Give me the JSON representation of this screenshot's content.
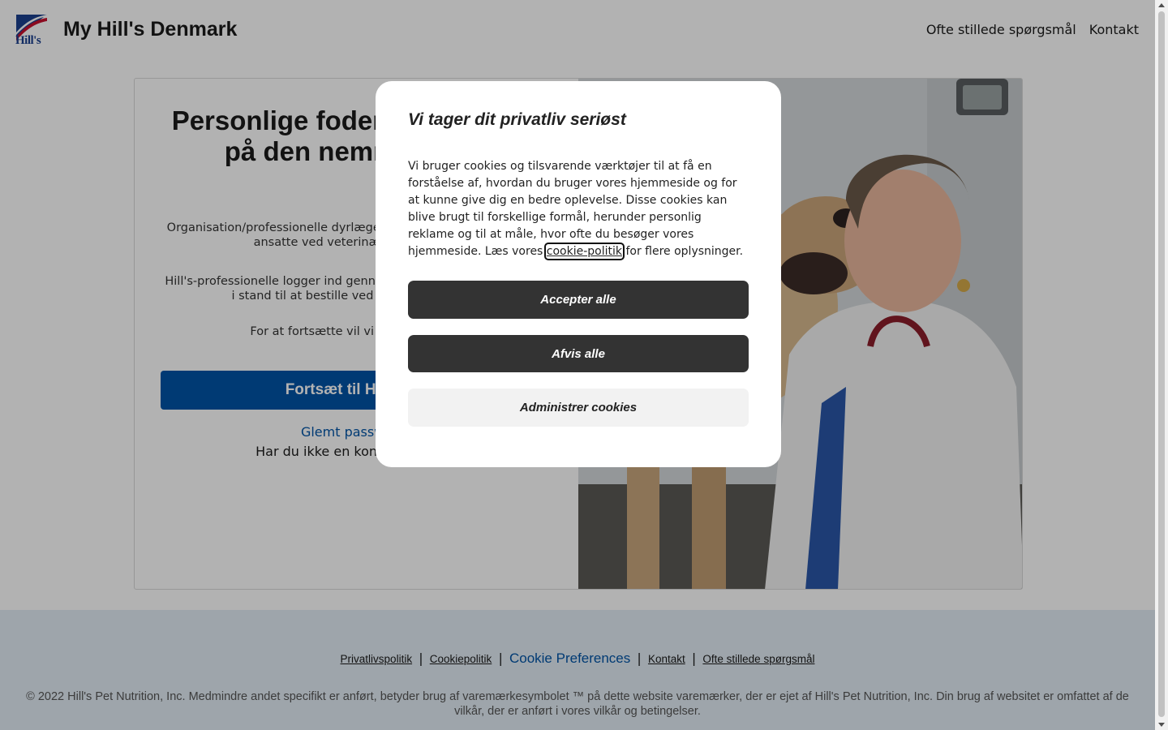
{
  "header": {
    "logo_text": "Hill's",
    "title": "My Hill's Denmark",
    "nav": [
      "Ofte stillede spørgsmål",
      "Kontakt"
    ]
  },
  "card": {
    "title": "Personlige foderanbefalinger på den nemme måde",
    "p1": "Organisation/professionelle dyrlæger, veterinærstuderende eller ansatte ved veterinæruniversiteter",
    "p2": "Hill's-professionelle logger ind gennem portalen, som vil gøre dig i stand til at bestille ved at bruge én konto",
    "p3": "For at fortsætte vil vi omdirigere dig",
    "cta": "Fortsæt til Hill's Vet",
    "forgot": "Glemt password?",
    "no_account": "Har du ikke en konto? Opret en"
  },
  "footer": {
    "links": [
      "Privatlivspolitik",
      "Cookiepolitik",
      "Cookie Preferences",
      "Kontakt",
      "Ofte stillede spørgsmål"
    ],
    "separator": "|",
    "copyright": "© 2022 Hill's Pet Nutrition, Inc. Medmindre andet specifikt er anført, betyder brug af varemærkesymbolet ™ på dette website varemærker, der er ejet af Hill's Pet Nutrition, Inc. Din brug af websitet er omfattet af de vilkår, der er anført i vores vilkår og betingelser."
  },
  "modal": {
    "title": "Vi tager dit privatliv seriøst",
    "body_before": "Vi bruger cookies og tilsvarende værktøjer til at få en forståelse af, hvordan du bruger vores hjemmeside og for at kunne give dig en bedre oplevelse. Disse cookies kan blive brugt til forskellige formål, herunder personlig reklame og til at måle, hvor ofte du besøger vores hjemmeside. Læs vores ",
    "body_link": "cookie-politik",
    "body_after": " for flere oplysninger.",
    "accept": "Accepter alle",
    "reject": "Afvis alle",
    "manage": "Administrer cookies"
  },
  "colors": {
    "brand_blue": "#0054a6",
    "modal_button_dark": "#333333",
    "footer_bg": "#e3edf5"
  }
}
